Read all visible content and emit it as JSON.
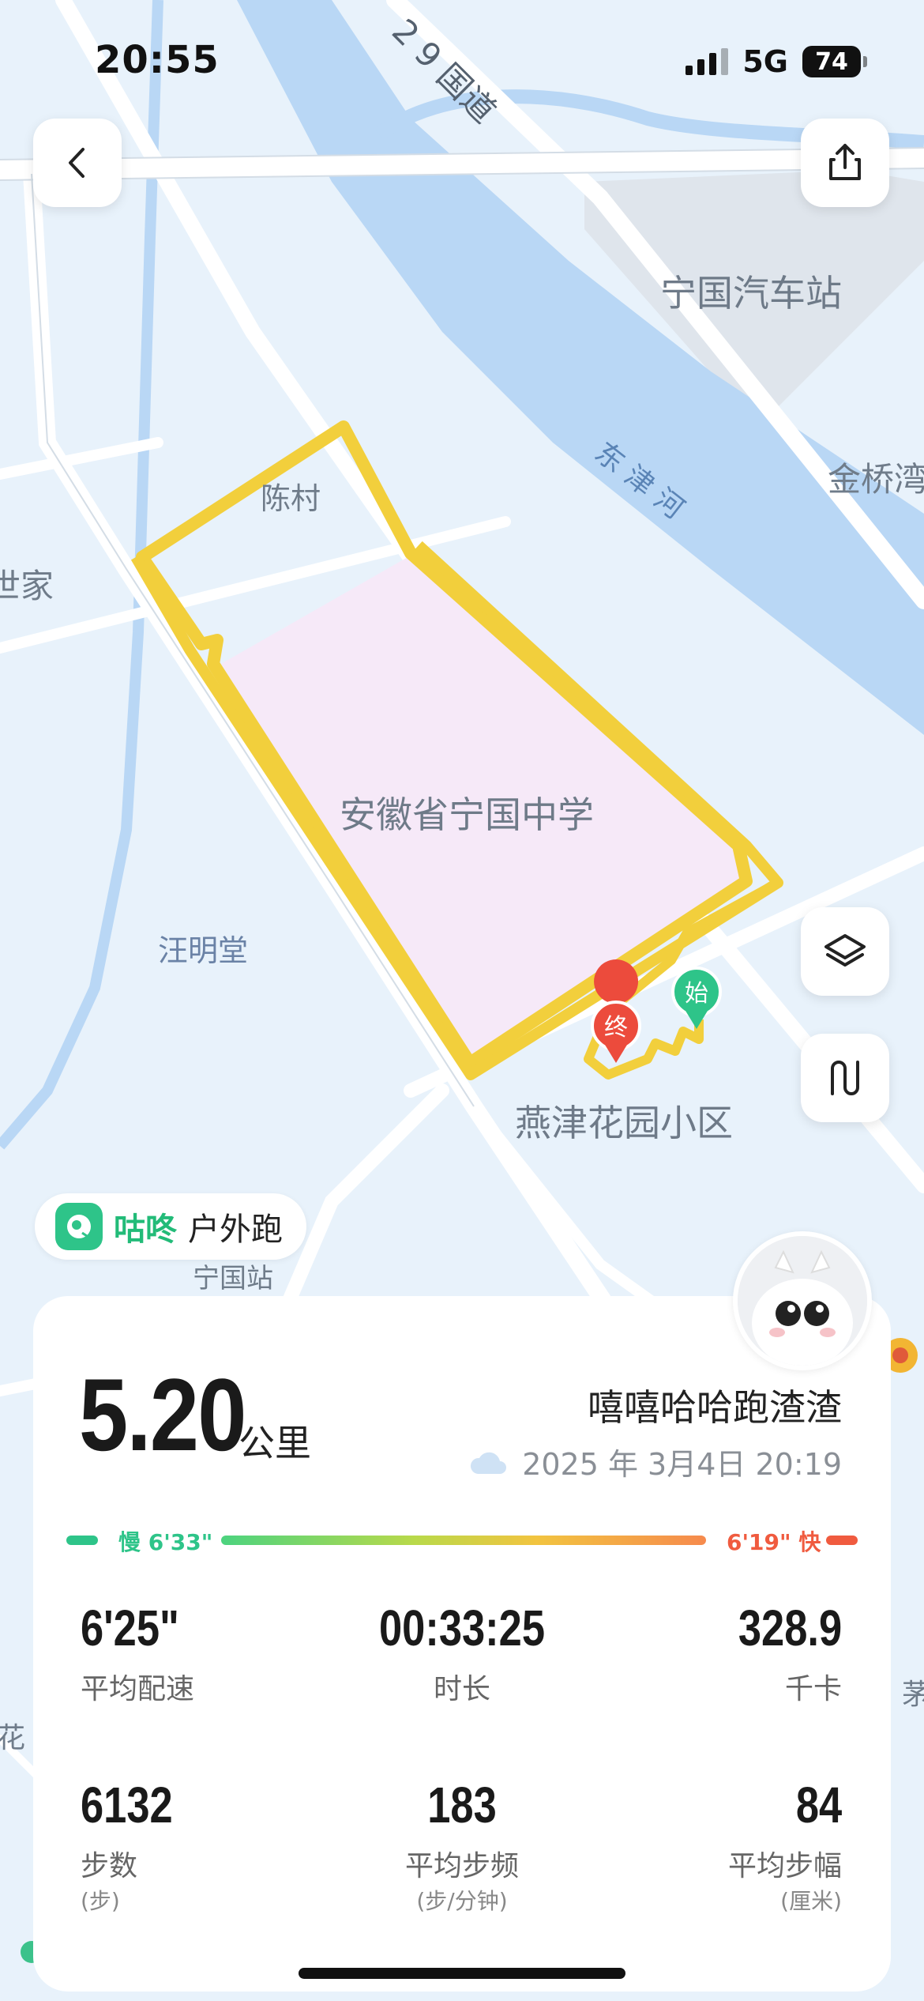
{
  "status_bar": {
    "time": "20:55",
    "network": "5G",
    "battery": "74"
  },
  "map": {
    "labels": {
      "road_29": "2 9 国道",
      "bus_station": "宁国汽车站",
      "river": "东 津 河",
      "jinqiao": "金桥湾",
      "chencun": "陈村",
      "shijia": "世家",
      "school": "安徽省宁国中学",
      "wangmingtang": "汪明堂",
      "yanjin": "燕津花园小区",
      "ningguo_station": "宁国站",
      "left_hua": "宁花",
      "right_mao": "茅"
    },
    "markers": {
      "start": "始",
      "end": "终"
    },
    "colors": {
      "route": "#f2cf3c",
      "school_area": "#f6e9f8",
      "river": "#b9d7f5",
      "start": "#2ec489",
      "end": "#ec4b3c"
    }
  },
  "buttons": {
    "back": "back-icon",
    "share": "share-icon",
    "layers": "layers-icon",
    "route_toggle": "route-icon"
  },
  "app": {
    "brand": "咕咚",
    "activity_type": "户外跑"
  },
  "summary": {
    "distance": "5.20",
    "distance_unit": "公里",
    "username": "嘻嘻哈哈跑渣渣",
    "weather_icon": "cloud-icon",
    "datetime": "2025 年 3月4日 20:19"
  },
  "pace_scale": {
    "slow_label": "慢 6'33\"",
    "fast_label": "6'19\" 快"
  },
  "stats": [
    {
      "value": "6'25\"",
      "label": "平均配速",
      "unit": ""
    },
    {
      "value": "00:33:25",
      "label": "时长",
      "unit": ""
    },
    {
      "value": "328.9",
      "label": "千卡",
      "unit": ""
    },
    {
      "value": "6132",
      "label": "步数",
      "unit": "(步)"
    },
    {
      "value": "183",
      "label": "平均步频",
      "unit": "(步/分钟)"
    },
    {
      "value": "84",
      "label": "平均步幅",
      "unit": "(厘米)"
    }
  ]
}
